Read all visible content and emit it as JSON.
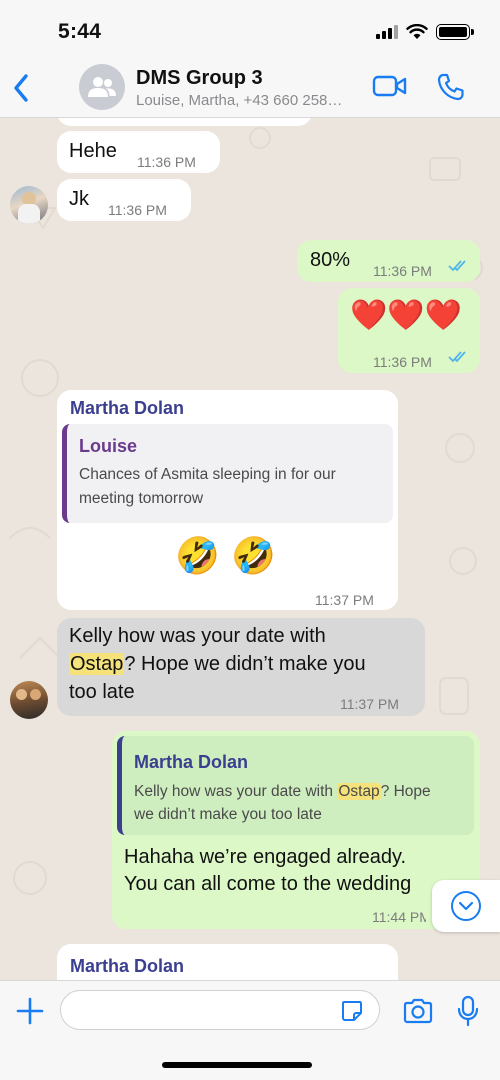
{
  "status_bar": {
    "time": "5:44"
  },
  "header": {
    "title": "DMS Group 3",
    "subtitle": "Louise, Martha, +43 660 258…"
  },
  "messages": [
    {
      "text": "Hehe",
      "time": "11:36 PM"
    },
    {
      "text": "Jk",
      "time": "11:36 PM"
    },
    {
      "text": "80%",
      "time": "11:36 PM"
    },
    {
      "text": "❤️❤️❤️",
      "time": "11:36 PM"
    },
    {
      "sender": "Martha Dolan",
      "quote_sender": "Louise",
      "quote_text_1": "Chances of Asmita sleeping in for our",
      "quote_text_2": "meeting tomorrow",
      "text": "🤣 🤣",
      "time": "11:37 PM"
    },
    {
      "text_line1": "Kelly how was your date with",
      "text_highlight": "Ostap",
      "text_line2_rest": "? Hope we didn’t make you",
      "text_line3": "too late",
      "time": "11:37 PM"
    },
    {
      "quote_sender": "Martha Dolan",
      "quote_prefix": "Kelly how was your date with ",
      "quote_highlight": "Ostap",
      "quote_suffix": "? Hope",
      "quote_line2": "we didn’t make you too late",
      "text_line1": "Hahaha we’re engaged already.",
      "text_line2": "You can all come to the wedding",
      "time": "11:44 PM"
    },
    {
      "sender": "Martha Dolan"
    }
  ],
  "colors": {
    "accent": "#1a7cf2",
    "outgoing_bubble": "#dcf8c6",
    "sender_name": "#3b3f8f",
    "highlight": "#f5e27a"
  },
  "icons": [
    "back-icon",
    "group-icon",
    "video-icon",
    "phone-icon",
    "plus-icon",
    "sticker-icon",
    "camera-icon",
    "mic-icon",
    "chevron-down-icon",
    "double-check-icon"
  ]
}
